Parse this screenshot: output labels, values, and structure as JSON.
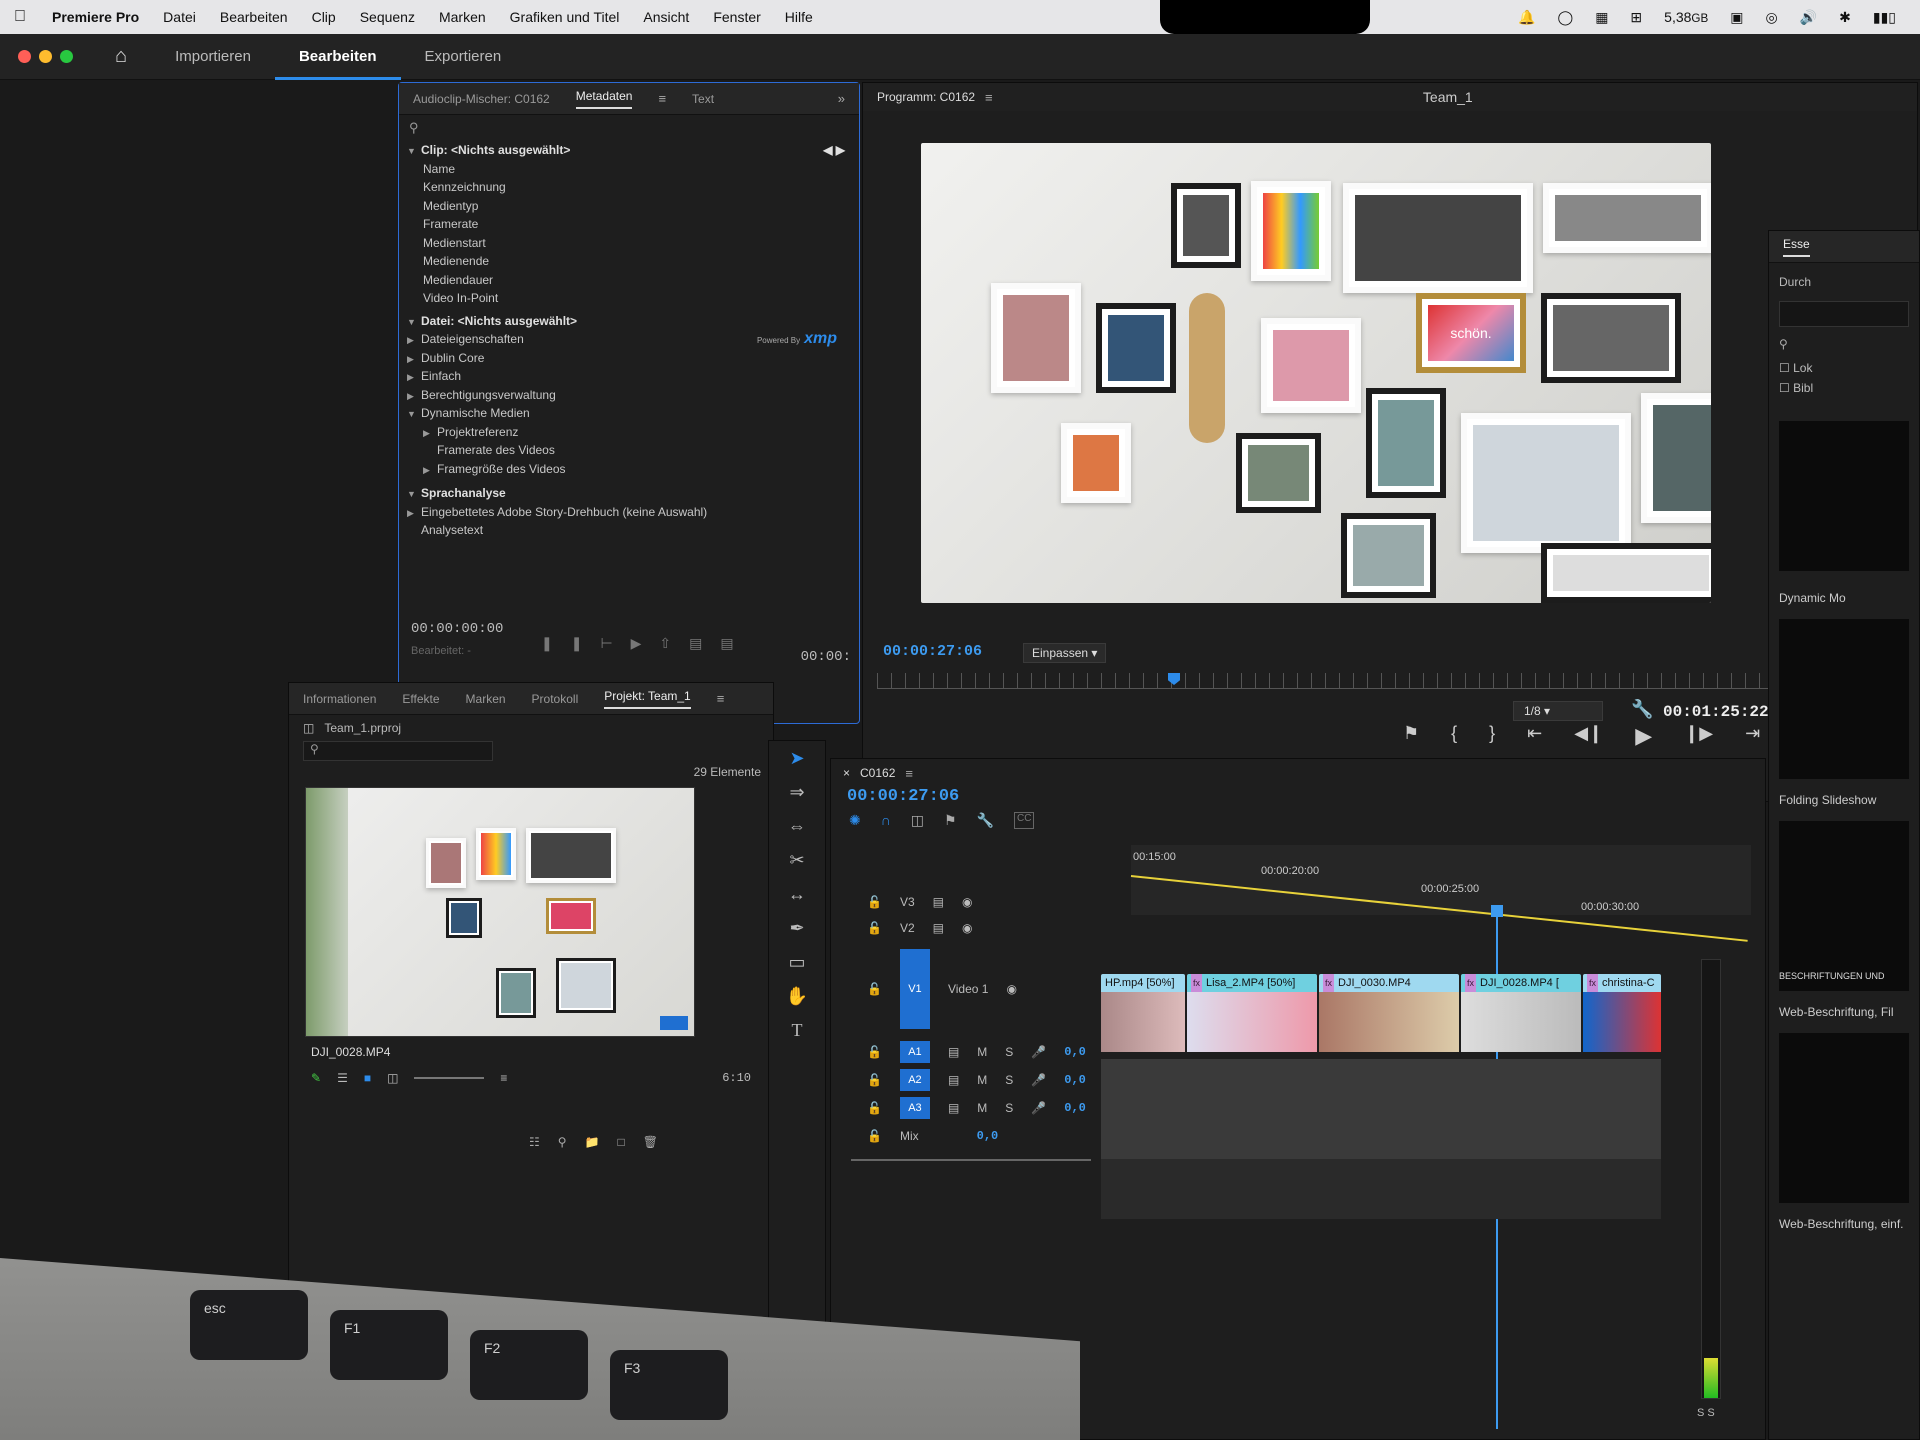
{
  "menubar": {
    "app": "Premiere Pro",
    "items": [
      "Datei",
      "Bearbeiten",
      "Clip",
      "Sequenz",
      "Marken",
      "Grafiken und Titel",
      "Ansicht",
      "Fenster",
      "Hilfe"
    ],
    "memory": "5,38",
    "memory_unit": "GB"
  },
  "workspace": {
    "tabs": [
      "Importieren",
      "Bearbeiten",
      "Exportieren"
    ],
    "active": "Bearbeiten"
  },
  "metadata_panel": {
    "tabs": [
      "Audioclip-Mischer: C0162",
      "Metadaten",
      "Text"
    ],
    "clip_header": "Clip:  <Nichts ausgewählt>",
    "clip_fields": [
      "Name",
      "Kennzeichnung",
      "Medientyp",
      "Framerate",
      "Medienstart",
      "Medienende",
      "Mediendauer",
      "Video In-Point"
    ],
    "file_header": "Datei:  <Nichts ausgewählt>",
    "file_sections": [
      "Dateieigenschaften",
      "Dublin Core",
      "Einfach",
      "Berechtigungsverwaltung",
      "Dynamische Medien"
    ],
    "dyn_sub": [
      "Projektreferenz",
      "Framerate des Videos",
      "Framegröße des Videos"
    ],
    "speech_header": "Sprachanalyse",
    "speech_items": [
      "Eingebettetes Adobe Story-Drehbuch (keine Auswahl)",
      "Analysetext"
    ],
    "powered_by": "Powered By",
    "xmp": "xmp",
    "timecode": "00:00:00:00",
    "edited_label": "Bearbeitet: -",
    "timecode_right": "00:00:"
  },
  "program": {
    "title": "Programm: C0162",
    "sequence": "Team_1",
    "timecode": "00:00:27:06",
    "fit": "Einpassen",
    "resolution": "1/8",
    "duration": "00:01:25:22",
    "poster_text": "schön."
  },
  "project": {
    "tabs": [
      "Informationen",
      "Effekte",
      "Marken",
      "Protokoll",
      "Projekt: Team_1"
    ],
    "file": "Team_1.prproj",
    "count": "29 Elemente",
    "thumb_name": "DJI_0028.MP4",
    "thumb_dur": "6:10"
  },
  "timeline": {
    "name": "C0162",
    "timecode": "00:00:27:06",
    "ruler": [
      "00:15:00",
      "00:00:20:00",
      "00:00:25:00",
      "00:00:30:00"
    ],
    "tracks": {
      "v3": "V3",
      "v2": "V2",
      "v1": "V1",
      "video1": "Video 1",
      "a1": "A1",
      "a2": "A2",
      "a3": "A3",
      "mix": "Mix",
      "m": "M",
      "s": "S",
      "vol": "0,0"
    },
    "clips": [
      "HP.mp4 [50%]",
      "Lisa_2.MP4 [50%]",
      "DJI_0030.MP4",
      "DJI_0028.MP4 [",
      "christina-C"
    ],
    "fx": "fx",
    "cc": "CC"
  },
  "right_panel": {
    "tab": "Esse",
    "search": "Durch",
    "checks": [
      "Lok",
      "Bibl"
    ],
    "items": [
      "Dynamic Mo",
      "Folding Slideshow",
      "BESCHRIFTUNGEN UND",
      "Web-Beschriftung, Fil",
      "Web-Beschriftung, einf."
    ]
  },
  "keyboard": {
    "keys": [
      "esc",
      "F1",
      "F2",
      "F3"
    ]
  }
}
